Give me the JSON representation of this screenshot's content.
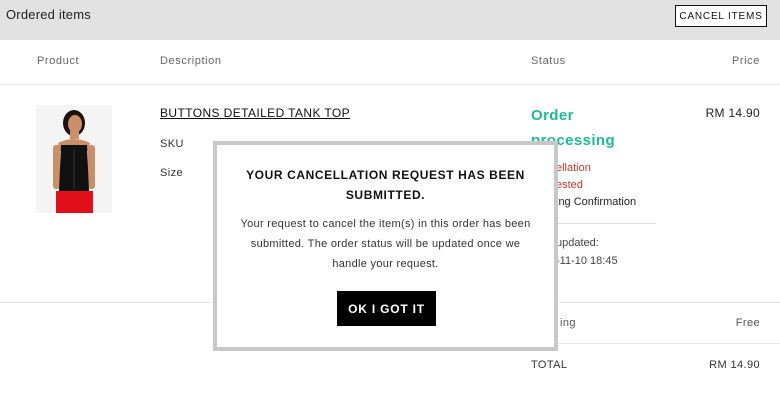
{
  "topbar": {
    "title": "Ordered items",
    "cancel_label": "CANCEL ITEMS"
  },
  "table_header": {
    "product": "Product",
    "description": "Description",
    "status": "Status",
    "price": "Price"
  },
  "item": {
    "name": "BUTTONS DETAILED TANK TOP",
    "sku_label": "SKU",
    "size_label": "Size",
    "status_line1": "Order",
    "status_line2": "processing",
    "status_red1": "ellation",
    "status_red2": "ested",
    "status_dark": "ing Confirmation",
    "updated_label": "updated:",
    "updated_value": "-11-10 18:45",
    "price": "RM 14.90"
  },
  "summary": {
    "shipping_label": "ing",
    "shipping_value": "Free",
    "total_label": "TOTAL",
    "total_value": "RM 14.90"
  },
  "modal": {
    "title": "YOUR CANCELLATION REQUEST HAS BEEN SUBMITTED.",
    "body": "Your request to cancel the item(s) in this order has been submitted. The order status will be updated once we handle your request.",
    "ok_label": "OK I GOT IT"
  },
  "colors": {
    "status_green": "#1fb99a",
    "status_red": "#c0392b",
    "topbar_bg": "#e2e2e2"
  }
}
